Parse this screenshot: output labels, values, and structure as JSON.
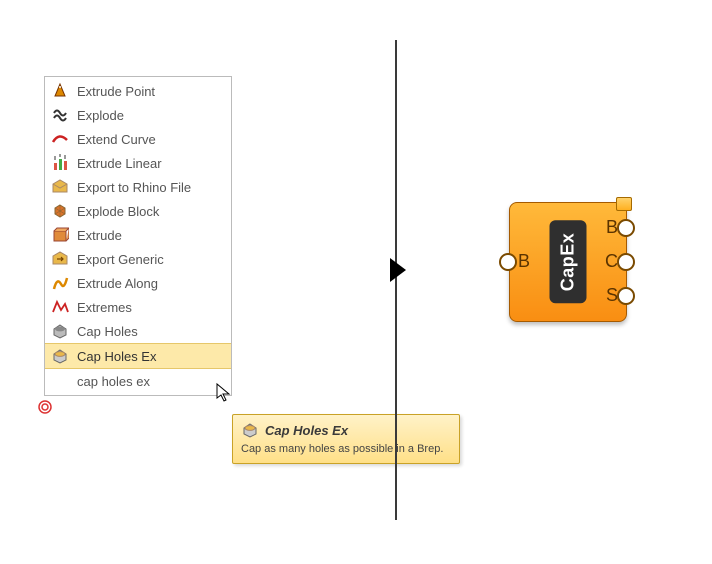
{
  "menu": {
    "items": [
      {
        "label": "Extrude Point",
        "icon": "extrude-point"
      },
      {
        "label": "Explode",
        "icon": "explode"
      },
      {
        "label": "Extend Curve",
        "icon": "extend-curve"
      },
      {
        "label": "Extrude Linear",
        "icon": "extrude-linear"
      },
      {
        "label": "Export to Rhino File",
        "icon": "export-rhino"
      },
      {
        "label": "Explode Block",
        "icon": "explode-block"
      },
      {
        "label": "Extrude",
        "icon": "extrude"
      },
      {
        "label": "Export Generic",
        "icon": "export-generic"
      },
      {
        "label": "Extrude Along",
        "icon": "extrude-along"
      },
      {
        "label": "Extremes",
        "icon": "extremes"
      },
      {
        "label": "Cap Holes",
        "icon": "cap-holes"
      },
      {
        "label": "Cap Holes Ex",
        "icon": "cap-holes-ex",
        "selected": true
      }
    ],
    "search_text": "cap holes ex"
  },
  "tooltip": {
    "title": "Cap Holes Ex",
    "description": "Cap as many holes as possible in a Brep."
  },
  "component": {
    "name": "CapEx",
    "inputs": [
      {
        "label": "B"
      }
    ],
    "outputs": [
      {
        "label": "B"
      },
      {
        "label": "C"
      },
      {
        "label": "S"
      }
    ]
  }
}
